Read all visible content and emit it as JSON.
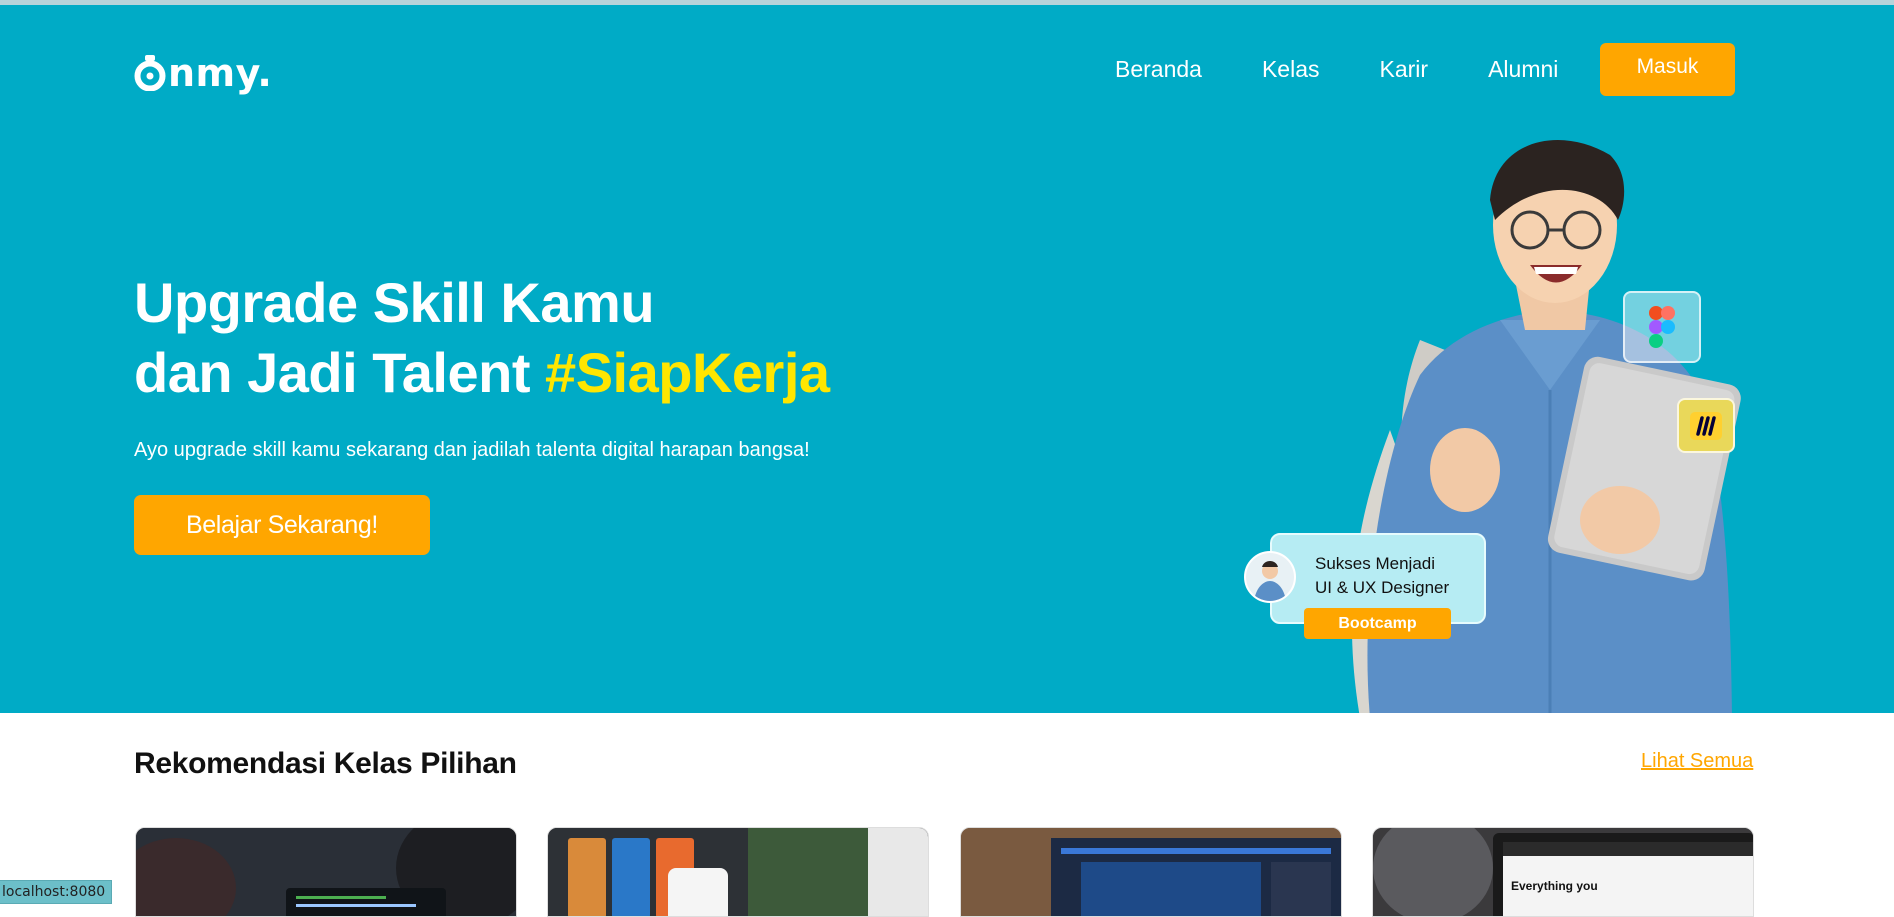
{
  "colors": {
    "hero_bg": "#00abc6",
    "accent": "#ffa600",
    "highlight": "#ffe600"
  },
  "brand": {
    "logo_text": "nmy."
  },
  "nav": {
    "items": [
      {
        "label": "Beranda"
      },
      {
        "label": "Kelas"
      },
      {
        "label": "Karir"
      },
      {
        "label": "Alumni"
      }
    ],
    "login_label": "Masuk"
  },
  "hero": {
    "headline_line1": "Upgrade Skill Kamu",
    "headline_line2_prefix": "dan Jadi Talent ",
    "headline_highlight": "#SiapKerja",
    "subtext": "Ayo upgrade skill kamu sekarang dan jadilah talenta digital harapan bangsa!",
    "cta_label": "Belajar Sekarang!",
    "success_card": {
      "line1": "Sukses Menjadi",
      "line2": "UI & UX Designer",
      "badge": "Bootcamp"
    },
    "app_icons": [
      "figma-icon",
      "miro-icon"
    ]
  },
  "recommendations": {
    "title": "Rekomendasi Kelas Pilihan",
    "see_all_label": "Lihat Semua",
    "cards": [
      {
        "image": "coding-laptop-thumbnail"
      },
      {
        "image": "mobile-design-thumbnail"
      },
      {
        "image": "photoshop-thumbnail"
      },
      {
        "image": "shopify-thumbnail",
        "visible_text": "Everything you"
      }
    ]
  },
  "status_bar": {
    "url": "localhost:8080"
  }
}
